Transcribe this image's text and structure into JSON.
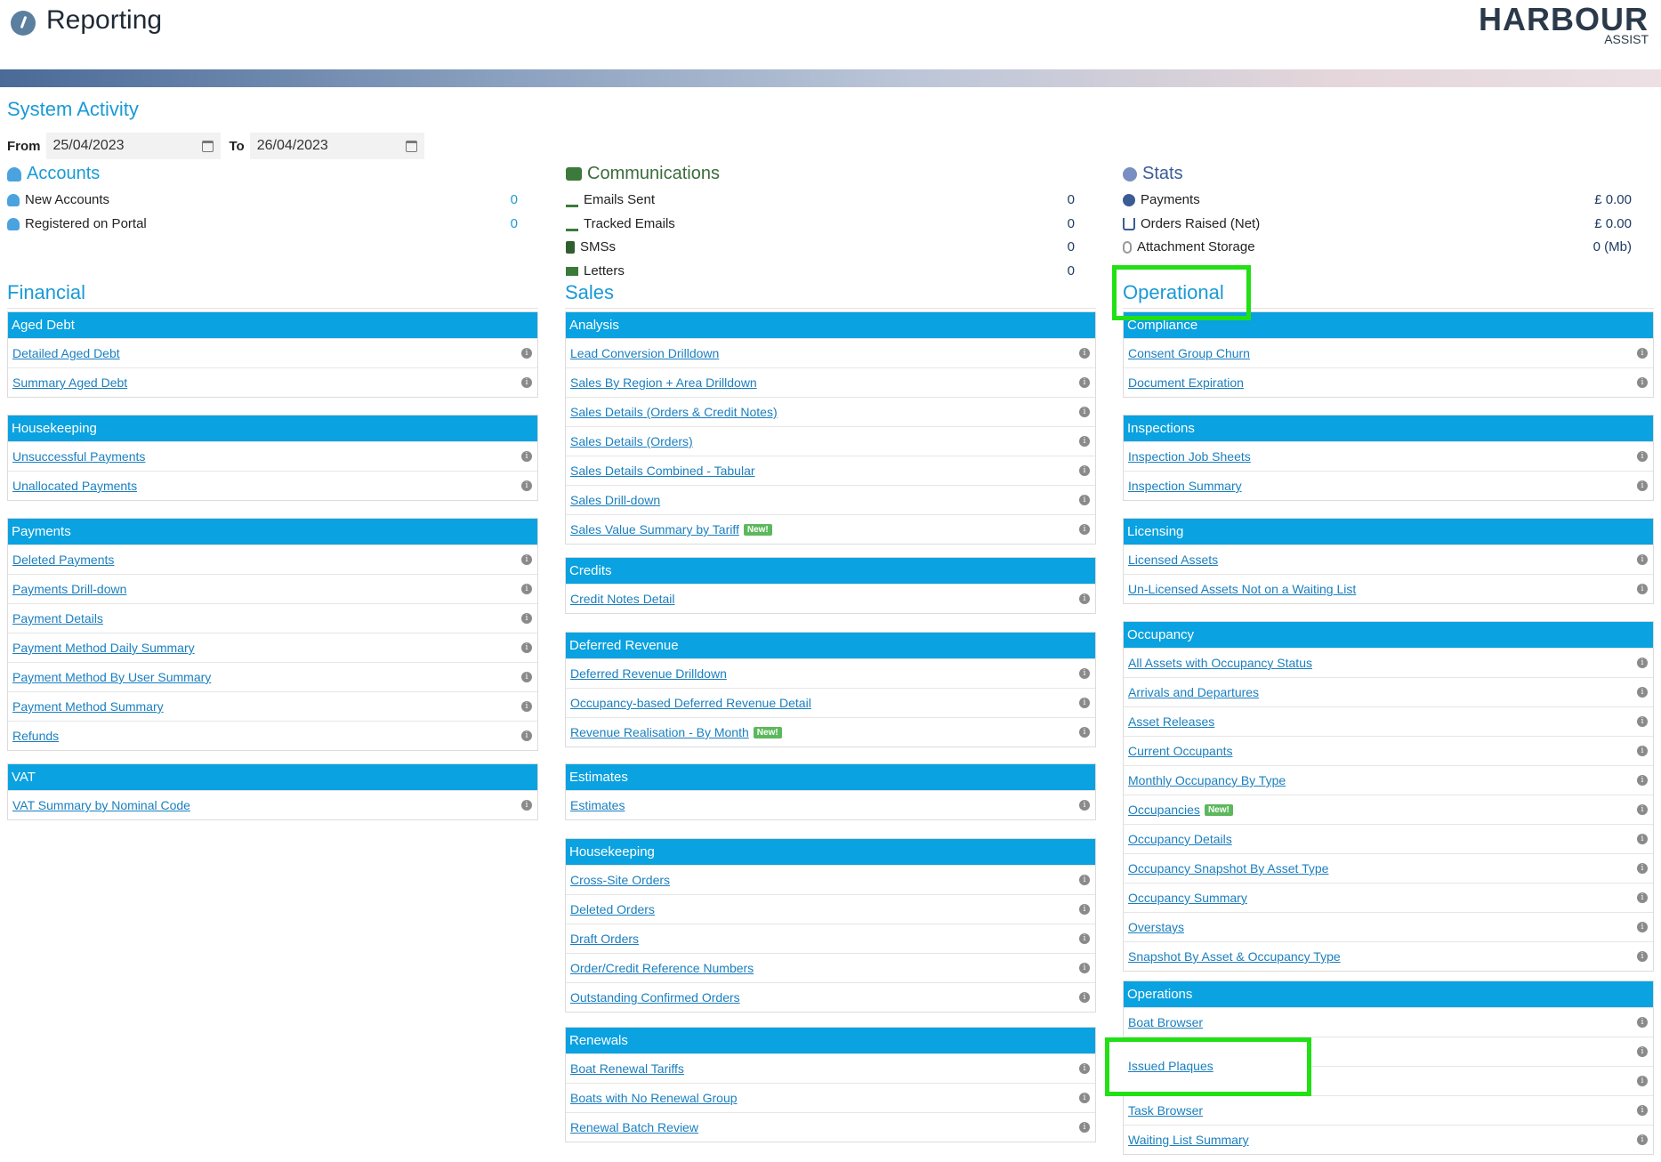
{
  "header": {
    "title": "Reporting",
    "logo_main": "HARBOUR",
    "logo_sub": "ASSIST"
  },
  "system_activity": {
    "title": "System Activity",
    "from_label": "From",
    "from_value": "25/04/2023",
    "to_label": "To",
    "to_value": "26/04/2023"
  },
  "accounts": {
    "title": "Accounts",
    "rows": [
      {
        "label": "New Accounts",
        "value": "0"
      },
      {
        "label": "Registered on Portal",
        "value": "0"
      }
    ]
  },
  "communications": {
    "title": "Communications",
    "rows": [
      {
        "label": "Emails Sent",
        "value": "0"
      },
      {
        "label": "Tracked Emails",
        "value": "0"
      },
      {
        "label": "SMSs",
        "value": "0"
      },
      {
        "label": "Letters",
        "value": "0"
      }
    ]
  },
  "stats": {
    "title": "Stats",
    "rows": [
      {
        "label": "Payments",
        "value": "£ 0.00"
      },
      {
        "label": "Orders Raised (Net)",
        "value": "£ 0.00"
      },
      {
        "label": "Attachment Storage",
        "value": "0 (Mb)"
      }
    ]
  },
  "badge_new": "New!",
  "info_glyph": "i",
  "columns": [
    {
      "title": "Financial",
      "panels": [
        {
          "heading": "Aged Debt",
          "items": [
            {
              "label": "Detailed Aged Debt"
            },
            {
              "label": "Summary Aged Debt"
            }
          ]
        },
        {
          "heading": "Housekeeping",
          "items": [
            {
              "label": "Unsuccessful Payments"
            },
            {
              "label": "Unallocated Payments"
            }
          ]
        },
        {
          "heading": "Payments",
          "items": [
            {
              "label": "Deleted Payments"
            },
            {
              "label": "Payments Drill-down"
            },
            {
              "label": "Payment Details"
            },
            {
              "label": "Payment Method Daily Summary"
            },
            {
              "label": "Payment Method By User Summary"
            },
            {
              "label": "Payment Method Summary"
            },
            {
              "label": "Refunds"
            }
          ]
        },
        {
          "heading": "VAT",
          "items": [
            {
              "label": "VAT Summary by Nominal Code"
            }
          ]
        }
      ]
    },
    {
      "title": "Sales",
      "panels": [
        {
          "heading": "Analysis",
          "items": [
            {
              "label": "Lead Conversion Drilldown"
            },
            {
              "label": "Sales By Region + Area Drilldown"
            },
            {
              "label": "Sales Details (Orders & Credit Notes)"
            },
            {
              "label": "Sales Details (Orders)"
            },
            {
              "label": "Sales Details Combined - Tabular"
            },
            {
              "label": "Sales Drill-down"
            },
            {
              "label": "Sales Value Summary by Tariff",
              "new": true
            }
          ]
        },
        {
          "heading": "Credits",
          "items": [
            {
              "label": "Credit Notes Detail"
            }
          ]
        },
        {
          "heading": "Deferred Revenue",
          "items": [
            {
              "label": "Deferred Revenue Drilldown"
            },
            {
              "label": "Occupancy-based Deferred Revenue Detail"
            },
            {
              "label": "Revenue Realisation - By Month",
              "new": true
            }
          ]
        },
        {
          "heading": "Estimates",
          "items": [
            {
              "label": "Estimates"
            }
          ]
        },
        {
          "heading": "Housekeeping",
          "items": [
            {
              "label": "Cross-Site Orders"
            },
            {
              "label": "Deleted Orders"
            },
            {
              "label": "Draft Orders"
            },
            {
              "label": "Order/Credit Reference Numbers"
            },
            {
              "label": "Outstanding Confirmed Orders"
            }
          ]
        },
        {
          "heading": "Renewals",
          "items": [
            {
              "label": "Boat Renewal Tariffs"
            },
            {
              "label": "Boats with No Renewal Group"
            },
            {
              "label": "Renewal Batch Review"
            }
          ]
        }
      ]
    },
    {
      "title": "Operational",
      "panels": [
        {
          "heading": "Compliance",
          "items": [
            {
              "label": "Consent Group Churn"
            },
            {
              "label": "Document Expiration"
            }
          ]
        },
        {
          "heading": "Inspections",
          "items": [
            {
              "label": "Inspection Job Sheets"
            },
            {
              "label": "Inspection Summary"
            }
          ]
        },
        {
          "heading": "Licensing",
          "items": [
            {
              "label": "Licensed Assets"
            },
            {
              "label": "Un-Licensed Assets Not on a Waiting List"
            }
          ]
        },
        {
          "heading": "Occupancy",
          "items": [
            {
              "label": "All Assets with Occupancy Status"
            },
            {
              "label": "Arrivals and Departures"
            },
            {
              "label": "Asset Releases"
            },
            {
              "label": "Current Occupants"
            },
            {
              "label": "Monthly Occupancy By Type"
            },
            {
              "label": "Occupancies",
              "new": true
            },
            {
              "label": "Occupancy Details"
            },
            {
              "label": "Occupancy Snapshot By Asset Type"
            },
            {
              "label": "Occupancy Summary"
            },
            {
              "label": "Overstays"
            },
            {
              "label": "Snapshot By Asset & Occupancy Type"
            }
          ]
        },
        {
          "heading": "Operations",
          "items": [
            {
              "label": "Boat Browser"
            },
            {
              "label": ""
            },
            {
              "label": "Issued Plaques"
            },
            {
              "label": "Task Browser"
            },
            {
              "label": "Waiting List Summary"
            }
          ]
        }
      ]
    }
  ]
}
